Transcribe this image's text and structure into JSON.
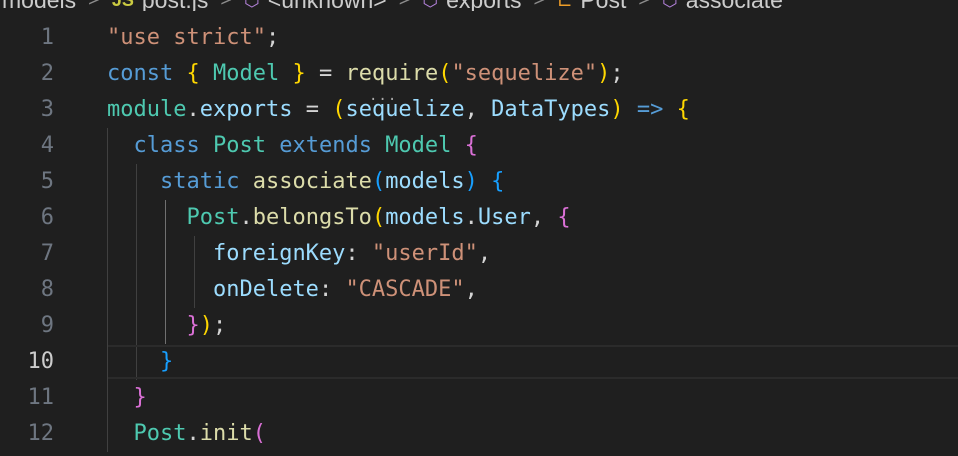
{
  "breadcrumb": {
    "items": [
      {
        "label": "models",
        "icon": "folder"
      },
      {
        "label": "post.js",
        "icon": "js-icon"
      },
      {
        "label": "<unknown>",
        "icon": "cube-icon"
      },
      {
        "label": "exports",
        "icon": "cube-icon"
      },
      {
        "label": "Post",
        "icon": "class-icon"
      },
      {
        "label": "associate",
        "icon": "cube-icon"
      }
    ],
    "separator": ">"
  },
  "editor": {
    "current_line": 10,
    "colors": {
      "keyword": "#569cd6",
      "string": "#ce9178",
      "class": "#4ec9b0",
      "function": "#dcdcaa",
      "variable": "#9cdcfe",
      "default": "#d4d4d4",
      "bracket1": "#ffd700",
      "bracket2": "#da70d6",
      "bracket3": "#179fff"
    },
    "lines": [
      {
        "n": "1",
        "tokens": [
          [
            "\"use strict\"",
            "string"
          ],
          [
            ";",
            "default"
          ]
        ]
      },
      {
        "n": "2",
        "tokens": [
          [
            "const",
            "keyword"
          ],
          [
            " ",
            "default"
          ],
          [
            "{",
            "bracket1"
          ],
          [
            " ",
            "default"
          ],
          [
            "Model",
            "class"
          ],
          [
            " ",
            "default"
          ],
          [
            "}",
            "bracket1"
          ],
          [
            " = ",
            "default"
          ],
          [
            "require",
            "function"
          ],
          [
            "(",
            "bracket1"
          ],
          [
            "\"sequelize\"",
            "string"
          ],
          [
            ")",
            "bracket1"
          ],
          [
            ";",
            "default"
          ]
        ]
      },
      {
        "n": "3",
        "tokens": [
          [
            "module",
            "class"
          ],
          [
            ".",
            "default"
          ],
          [
            "exports",
            "variable"
          ],
          [
            " = ",
            "default"
          ],
          [
            "(",
            "bracket1"
          ],
          [
            "sequelize",
            "variable"
          ],
          [
            ", ",
            "default"
          ],
          [
            "DataTypes",
            "variable"
          ],
          [
            ")",
            "bracket1"
          ],
          [
            " ",
            "default"
          ],
          [
            "=>",
            "keyword"
          ],
          [
            " ",
            "default"
          ],
          [
            "{",
            "bracket1"
          ]
        ]
      },
      {
        "n": "4",
        "tokens": [
          [
            "  ",
            "default"
          ],
          [
            "class",
            "keyword"
          ],
          [
            " ",
            "default"
          ],
          [
            "Post",
            "class"
          ],
          [
            " ",
            "default"
          ],
          [
            "extends",
            "keyword"
          ],
          [
            " ",
            "default"
          ],
          [
            "Model",
            "class"
          ],
          [
            " ",
            "default"
          ],
          [
            "{",
            "bracket2"
          ]
        ]
      },
      {
        "n": "5",
        "tokens": [
          [
            "    ",
            "default"
          ],
          [
            "static",
            "keyword"
          ],
          [
            " ",
            "default"
          ],
          [
            "associate",
            "function"
          ],
          [
            "(",
            "bracket3"
          ],
          [
            "models",
            "variable"
          ],
          [
            ")",
            "bracket3"
          ],
          [
            " ",
            "default"
          ],
          [
            "{",
            "bracket3"
          ]
        ]
      },
      {
        "n": "6",
        "tokens": [
          [
            "      ",
            "default"
          ],
          [
            "Post",
            "class"
          ],
          [
            ".",
            "default"
          ],
          [
            "belongsTo",
            "function"
          ],
          [
            "(",
            "bracket1"
          ],
          [
            "models",
            "variable"
          ],
          [
            ".",
            "default"
          ],
          [
            "User",
            "variable"
          ],
          [
            ", ",
            "default"
          ],
          [
            "{",
            "bracket2"
          ]
        ]
      },
      {
        "n": "7",
        "tokens": [
          [
            "        ",
            "default"
          ],
          [
            "foreignKey",
            "variable"
          ],
          [
            ": ",
            "default"
          ],
          [
            "\"userId\"",
            "string"
          ],
          [
            ",",
            "default"
          ]
        ]
      },
      {
        "n": "8",
        "tokens": [
          [
            "        ",
            "default"
          ],
          [
            "onDelete",
            "variable"
          ],
          [
            ": ",
            "default"
          ],
          [
            "\"CASCADE\"",
            "string"
          ],
          [
            ",",
            "default"
          ]
        ]
      },
      {
        "n": "9",
        "tokens": [
          [
            "      ",
            "default"
          ],
          [
            "}",
            "bracket2"
          ],
          [
            ")",
            "bracket1"
          ],
          [
            ";",
            "default"
          ]
        ]
      },
      {
        "n": "10",
        "tokens": [
          [
            "    ",
            "default"
          ],
          [
            "}",
            "bracket3"
          ]
        ]
      },
      {
        "n": "11",
        "tokens": [
          [
            "  ",
            "default"
          ],
          [
            "}",
            "bracket2"
          ]
        ]
      },
      {
        "n": "12",
        "tokens": [
          [
            "  ",
            "default"
          ],
          [
            "Post",
            "class"
          ],
          [
            ".",
            "default"
          ],
          [
            "init",
            "function"
          ],
          [
            "(",
            "bracket2"
          ]
        ]
      }
    ]
  }
}
